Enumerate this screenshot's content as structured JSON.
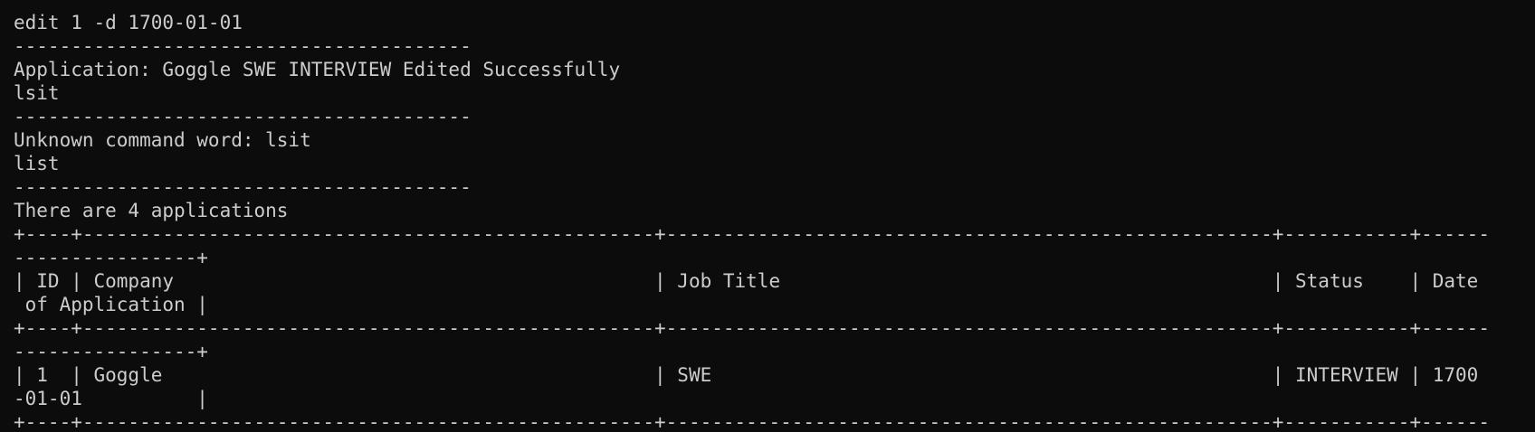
{
  "terminal": {
    "lines": [
      "edit 1 -d 1700-01-01",
      "----------------------------------------",
      "Application: Goggle SWE INTERVIEW Edited Successfully",
      "lsit",
      "----------------------------------------",
      "Unknown command word: lsit",
      "list",
      "----------------------------------------",
      "There are 4 applications",
      "+----+--------------------------------------------------+-----------------------------------------------------+-----------+------",
      "----------------+",
      "| ID | Company                                          | Job Title                                           | Status    | Date",
      " of Application |",
      "+----+--------------------------------------------------+-----------------------------------------------------+-----------+------",
      "----------------+",
      "| 1  | Goggle                                           | SWE                                                 | INTERVIEW | 1700",
      "-01-01          |",
      "+----+--------------------------------------------------+-----------------------------------------------------+-----------+------"
    ]
  }
}
